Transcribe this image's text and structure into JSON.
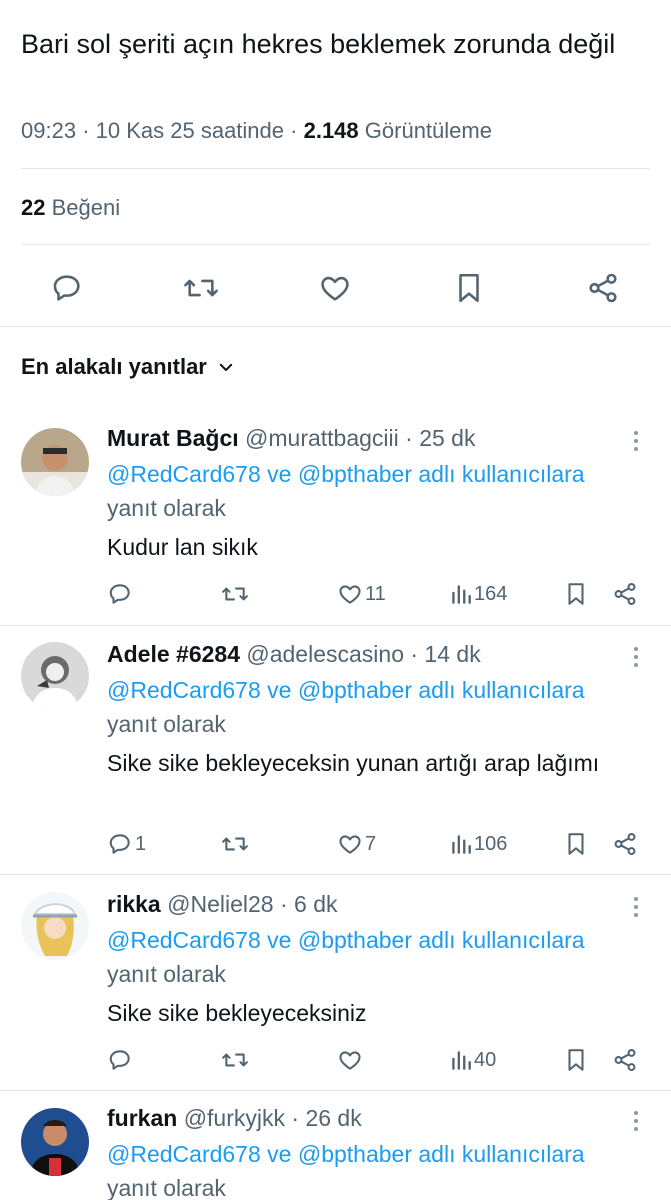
{
  "tweet": {
    "text": "Bari sol şeriti açın hekres beklemek zorunda değil",
    "time": "09:23",
    "date": "10 Kas 25 saatinde",
    "views_count": "2.148",
    "views_label": "Görüntüleme",
    "likes_count": "22",
    "likes_label": "Beğeni"
  },
  "actions": {
    "icons": [
      "reply-icon",
      "retweet-icon",
      "like-icon",
      "bookmark-icon",
      "share-icon"
    ]
  },
  "replies_sort": {
    "label": "En alakalı yanıtlar"
  },
  "replies": [
    {
      "name": "Murat Bağcı",
      "handle": "@murattbagciii",
      "time": "· 25 dk",
      "mentions": "@RedCard678 ve @bpthaber adlı kullanıcılara",
      "replying_to": "yanıt olarak",
      "text": "Kudur lan sikık",
      "reply_count": "",
      "like_count": "11",
      "view_count": "164"
    },
    {
      "name": "Adele #6284",
      "handle": "@adelescasino",
      "time": "· 14 dk",
      "mentions": "@RedCard678 ve @bpthaber adlı kullanıcılara",
      "replying_to": "yanıt olarak",
      "text": "Sike sike bekleyeceksin yunan artığı arap lağımı",
      "reply_count": "1",
      "like_count": "7",
      "view_count": "106"
    },
    {
      "name": "rikka",
      "handle": "@Neliel28",
      "time": "· 6 dk",
      "mentions": "@RedCard678 ve @bpthaber adlı kullanıcılara",
      "replying_to": "yanıt olarak",
      "text": "Sike sike bekleyeceksiniz",
      "reply_count": "",
      "like_count": "",
      "view_count": "40"
    },
    {
      "name": "furkan",
      "handle": "@furkyjkk",
      "time": "· 26 dk",
      "mentions": "@RedCard678 ve @bpthaber adlı kullanıcılara",
      "replying_to": "yanıt olarak",
      "text": "",
      "reply_count": "",
      "like_count": "",
      "view_count": ""
    }
  ],
  "colors": {
    "link": "#1d9bf0",
    "secondary_text": "#536471",
    "primary_text": "#0f1419",
    "divider": "#e1e6ea"
  }
}
